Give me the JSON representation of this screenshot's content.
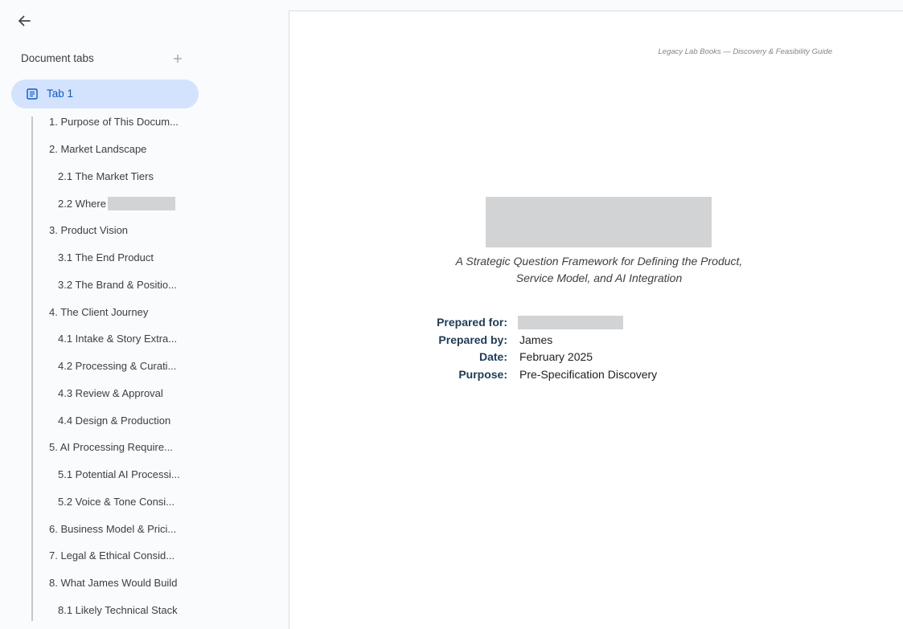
{
  "sidebar": {
    "back_icon": "arrow-back-icon",
    "tabs_header": "Document tabs",
    "add_tab_icon": "plus-icon",
    "active_tab": {
      "label": "Tab 1",
      "icon": "document-icon"
    },
    "outline": [
      {
        "label": "1. Purpose of This Docum...",
        "level": 1
      },
      {
        "label": "2. Market Landscape",
        "level": 1
      },
      {
        "label": "2.1 The Market Tiers",
        "level": 2
      },
      {
        "label": "2.2 Where",
        "level": 2,
        "redacted": true
      },
      {
        "label": "3. Product Vision",
        "level": 1
      },
      {
        "label": "3.1 The End Product",
        "level": 2
      },
      {
        "label": "3.2 The Brand & Positio...",
        "level": 2
      },
      {
        "label": "4. The Client Journey",
        "level": 1
      },
      {
        "label": "4.1 Intake & Story Extra...",
        "level": 2
      },
      {
        "label": "4.2 Processing & Curati...",
        "level": 2
      },
      {
        "label": "4.3 Review & Approval",
        "level": 2
      },
      {
        "label": "4.4 Design & Production",
        "level": 2
      },
      {
        "label": "5. AI Processing Require...",
        "level": 1
      },
      {
        "label": "5.1 Potential AI Processi...",
        "level": 2
      },
      {
        "label": "5.2 Voice & Tone Consi...",
        "level": 2
      },
      {
        "label": "6. Business Model & Prici...",
        "level": 1
      },
      {
        "label": "7. Legal & Ethical Consid...",
        "level": 1
      },
      {
        "label": "8. What James Would Build",
        "level": 1
      },
      {
        "label": "8.1 Likely Technical Stack",
        "level": 2
      }
    ]
  },
  "document": {
    "header_text": "Legacy Lab Books — Discovery & Feasibility Guide",
    "subtitle_line1": "A Strategic Question Framework for Defining the Product,",
    "subtitle_line2": "Service Model, and AI Integration",
    "meta": {
      "prepared_for_label": "Prepared for:",
      "prepared_by_label": "Prepared by:",
      "prepared_by_value": "James",
      "date_label": "Date:",
      "date_value": "February 2025",
      "purpose_label": "Purpose:",
      "purpose_value": "Pre-Specification Discovery"
    }
  },
  "colors": {
    "active_tab_bg": "#d3e3fd",
    "active_tab_text": "#0b57d0",
    "meta_label": "#1f3b57",
    "redaction": "#d2d3d5"
  }
}
